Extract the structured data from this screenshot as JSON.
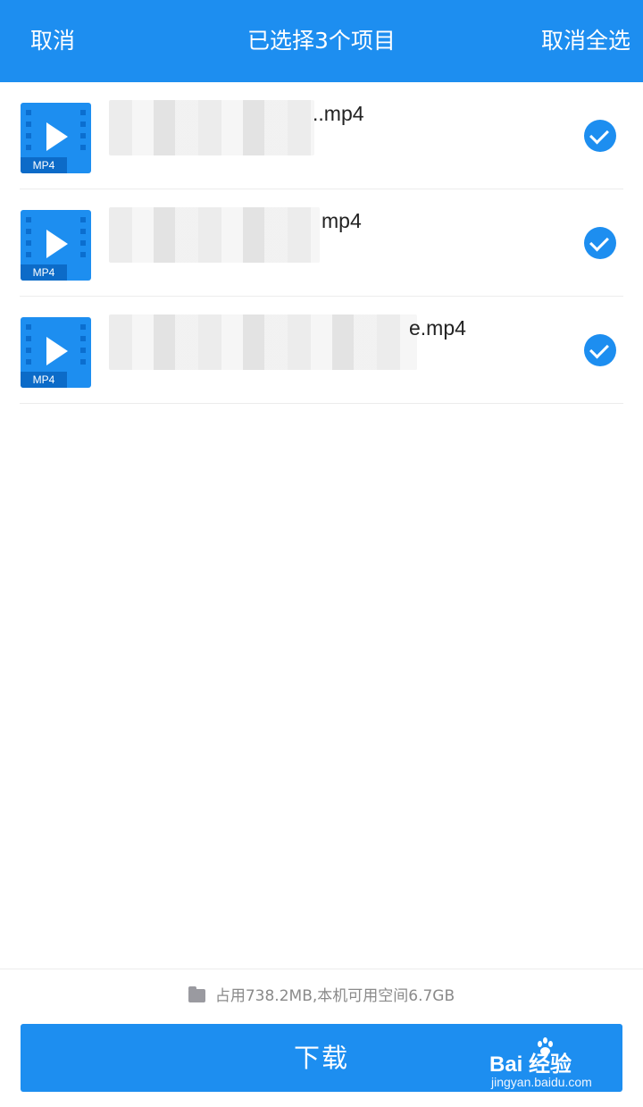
{
  "header": {
    "cancel_label": "取消",
    "title": "已选择3个项目",
    "deselect_all_label": "取消全选"
  },
  "files": [
    {
      "name_suffix": "..mp4",
      "type_tag": "MP4",
      "selected": true
    },
    {
      "name_suffix": "mp4",
      "type_tag": "MP4",
      "selected": true
    },
    {
      "name_suffix": "e.mp4",
      "type_tag": "MP4",
      "selected": true
    }
  ],
  "footer": {
    "storage_text": "占用738.2MB,本机可用空间6.7GB",
    "download_label": "下载"
  },
  "watermark": {
    "brand": "Bai  经验",
    "site": "jingyan.baidu.com"
  },
  "colors": {
    "accent": "#1d8ef0",
    "background": "#ffffff"
  },
  "icons": [
    "video-file-icon",
    "check-circle-icon",
    "folder-icon"
  ]
}
